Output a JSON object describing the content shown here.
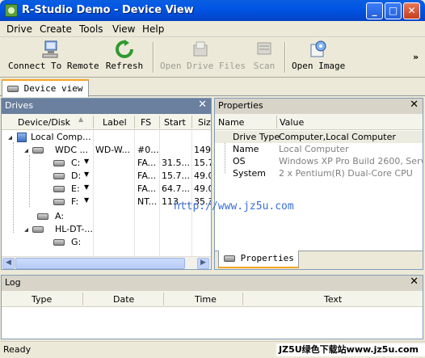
{
  "window": {
    "title": "R-Studio Demo - Device View"
  },
  "menu": [
    "Drive",
    "Create",
    "Tools",
    "View",
    "Help"
  ],
  "toolbar": {
    "connect": "Connect To Remote",
    "refresh": "Refresh",
    "open_files": "Open Drive Files",
    "scan": "Scan",
    "open_image": "Open Image",
    "more": "»"
  },
  "tabs": {
    "device_view": "Device view"
  },
  "drives_panel": {
    "title": "Drives",
    "columns": [
      "Device/Disk",
      "Label",
      "FS",
      "Start",
      "Siz"
    ],
    "rows": [
      {
        "device": "Local Comp...",
        "label": "",
        "fs": "",
        "start": "",
        "size": ""
      },
      {
        "device": "WDC ...",
        "label": "WD-W...",
        "fs": "#0...",
        "start": "",
        "size": "149."
      },
      {
        "device": "C:",
        "label": "",
        "fs": "FA...",
        "start": "31.5...",
        "size": "15.7"
      },
      {
        "device": "D:",
        "label": "",
        "fs": "FA...",
        "start": "15.7...",
        "size": "49.0"
      },
      {
        "device": "E:",
        "label": "",
        "fs": "FA...",
        "start": "64.7...",
        "size": "49.0"
      },
      {
        "device": "F:",
        "label": "",
        "fs": "NT...",
        "start": "113....",
        "size": "35.3"
      },
      {
        "device": "A:",
        "label": "",
        "fs": "",
        "start": "",
        "size": ""
      },
      {
        "device": "HL-DT-...",
        "label": "",
        "fs": "",
        "start": "",
        "size": ""
      },
      {
        "device": "G:",
        "label": "",
        "fs": "",
        "start": "",
        "size": ""
      }
    ]
  },
  "properties_panel": {
    "title": "Properties",
    "columns": [
      "Name",
      "Value"
    ],
    "rows": [
      {
        "name": "Drive Type",
        "value": "Computer,Local Computer"
      },
      {
        "name": "Name",
        "value": "Local Computer"
      },
      {
        "name": "OS",
        "value": "Windows XP Pro Build 2600, Servi..."
      },
      {
        "name": "System",
        "value": "2 x Pentium(R) Dual-Core  CPU"
      }
    ],
    "tab": "Properties"
  },
  "log_panel": {
    "title": "Log",
    "columns": [
      "Type",
      "Date",
      "Time",
      "Text"
    ]
  },
  "status": {
    "text": "Ready"
  },
  "watermark": "http://www.jz5u.com",
  "banner": "JZ5U绿色下载站www.jz5u.com",
  "colors": {
    "title_bar": "#0055e5",
    "panel_title": "#6b7f9f",
    "tab_accent": "#f5a623",
    "link_watermark": "#3a6fd8"
  }
}
